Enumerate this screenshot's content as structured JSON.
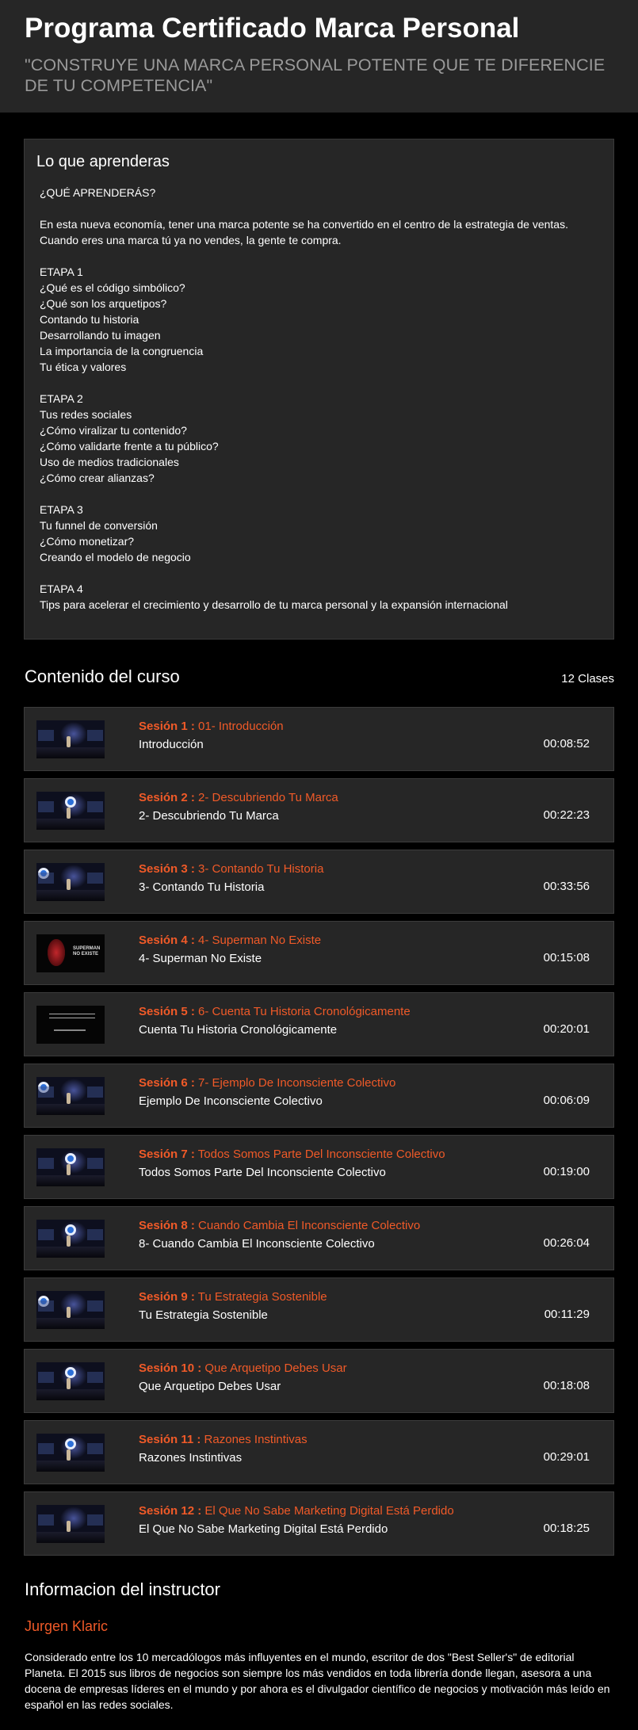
{
  "header": {
    "title": "Programa Certificado Marca Personal",
    "subtitle": "\"CONSTRUYE UNA MARCA PERSONAL POTENTE QUE TE DIFERENCIE DE TU COMPETENCIA\""
  },
  "learn": {
    "heading": "Lo que aprenderas",
    "lines": [
      "¿QUÉ APRENDERÁS?",
      "",
      "En esta nueva economía, tener una marca potente se ha convertido en el centro de la estrategia de ventas.",
      "Cuando eres una marca tú ya no vendes, la gente te compra.",
      "",
      "ETAPA 1",
      "¿Qué es el código simbólico?",
      "¿Qué son los arquetipos?",
      "Contando tu historia",
      "Desarrollando tu imagen",
      "La importancia de la congruencia",
      "Tu ética y valores",
      "",
      "ETAPA 2",
      "Tus redes sociales",
      "¿Cómo viralizar tu contenido?",
      "¿Cómo validarte frente a tu público?",
      "Uso de medios tradicionales",
      "¿Cómo crear alianzas?",
      "",
      "ETAPA 3",
      "Tu funnel de conversión",
      "¿Cómo monetizar?",
      "Creando el modelo de negocio",
      "",
      "ETAPA 4",
      "Tips para acelerar el crecimiento y desarrollo de tu marca personal y la expansión internacional"
    ]
  },
  "content": {
    "heading": "Contenido del curso",
    "count": "12 Clases",
    "sessions": [
      {
        "label": "Sesión 1 :",
        "title": "01- Introducción",
        "subtitle": "Introducción",
        "duration": "00:08:52",
        "thumb": "stage-blue"
      },
      {
        "label": "Sesión 2 :",
        "title": "2- Descubriendo Tu Marca",
        "subtitle": "2- Descubriendo Tu Marca",
        "duration": "00:22:23",
        "thumb": "stage-logo"
      },
      {
        "label": "Sesión 3 :",
        "title": "3- Contando Tu Historia",
        "subtitle": "3- Contando Tu Historia",
        "duration": "00:33:56",
        "thumb": "stage-logo-left"
      },
      {
        "label": "Sesión 4 :",
        "title": "4- Superman No Existe",
        "subtitle": "4- Superman No Existe",
        "duration": "00:15:08",
        "thumb": "superman"
      },
      {
        "label": "Sesión 5 :",
        "title": "6- Cuenta Tu Historia Cronológicamente",
        "subtitle": "Cuenta Tu Historia Cronológicamente",
        "duration": "00:20:01",
        "thumb": "text-slide"
      },
      {
        "label": "Sesión 6 :",
        "title": "7- Ejemplo De Inconsciente Colectivo",
        "subtitle": "Ejemplo De Inconsciente Colectivo",
        "duration": "00:06:09",
        "thumb": "stage-logo-left"
      },
      {
        "label": "Sesión 7 :",
        "title": "Todos Somos Parte Del Inconsciente Colectivo",
        "subtitle": "Todos Somos Parte Del Inconsciente Colectivo",
        "duration": "00:19:00",
        "thumb": "stage-logo"
      },
      {
        "label": "Sesión 8 :",
        "title": "Cuando Cambia El Inconsciente Colectivo",
        "subtitle": "8- Cuando Cambia El Inconsciente Colectivo",
        "duration": "00:26:04",
        "thumb": "stage-logo"
      },
      {
        "label": "Sesión 9 :",
        "title": "Tu Estrategia Sostenible",
        "subtitle": "Tu Estrategia Sostenible",
        "duration": "00:11:29",
        "thumb": "stage-logo-left"
      },
      {
        "label": "Sesión 10 :",
        "title": "Que Arquetipo Debes Usar",
        "subtitle": "Que Arquetipo Debes Usar",
        "duration": "00:18:08",
        "thumb": "stage-logo"
      },
      {
        "label": "Sesión 11 :",
        "title": "Razones Instintivas",
        "subtitle": "Razones Instintivas",
        "duration": "00:29:01",
        "thumb": "stage-logo"
      },
      {
        "label": "Sesión 12 :",
        "title": "El Que No Sabe Marketing Digital Está Perdido",
        "subtitle": "El Que No Sabe Marketing Digital Está Perdido",
        "duration": "00:18:25",
        "thumb": "stage-blue"
      }
    ]
  },
  "instructor": {
    "heading": "Informacion del instructor",
    "name": "Jurgen Klaric",
    "bio": "Considerado entre los 10 mercadólogos más influyentes en el mundo, escritor de dos \"Best Seller's\" de editorial Planeta. El 2015 sus libros de negocios son siempre los más vendidos en toda librería donde llegan, asesora a una docena de empresas líderes en el mundo y por ahora es el divulgador científico de negocios y motivación más leído en español en las redes sociales."
  },
  "colors": {
    "accent": "#f05a28",
    "panel": "#262626",
    "background": "#000000"
  }
}
